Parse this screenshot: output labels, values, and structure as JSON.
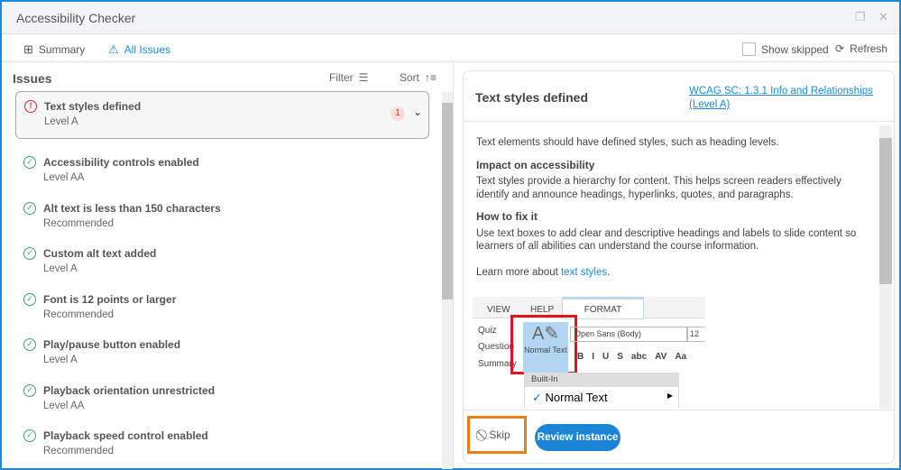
{
  "window": {
    "title": "Accessibility Checker"
  },
  "toolbar": {
    "summary": "Summary",
    "all_issues": "All Issues",
    "show_skipped": "Show skipped",
    "refresh": "Refresh"
  },
  "issues": {
    "heading": "Issues",
    "filter": "Filter",
    "sort": "Sort",
    "selected": {
      "title": "Text styles defined",
      "level": "Level A",
      "count": "1"
    },
    "items": [
      {
        "title": "Accessibility controls enabled",
        "level": "Level AA"
      },
      {
        "title": "Alt text is less than 150 characters",
        "level": "Recommended"
      },
      {
        "title": "Custom alt text added",
        "level": "Level A"
      },
      {
        "title": "Font is 12 points or larger",
        "level": "Recommended"
      },
      {
        "title": "Play/pause button enabled",
        "level": "Level A"
      },
      {
        "title": "Playback orientation unrestricted",
        "level": "Level AA"
      },
      {
        "title": "Playback speed control enabled",
        "level": "Recommended"
      }
    ]
  },
  "detail": {
    "title": "Text styles defined",
    "wcag_link": "WCAG SC: 1.3.1 Info and Relationships (Level A)",
    "intro": "Text elements should have defined styles, such as heading levels.",
    "impact_heading": "Impact on accessibility",
    "impact_text": "Text styles provide a hierarchy for content. This helps screen readers effectively identify and announce headings, hyperlinks, quotes, and paragraphs.",
    "fix_heading": "How to fix it",
    "fix_text": "Use text boxes to add clear and descriptive headings and labels to slide content so learners of all abilities can understand the course information.",
    "learn_more": "Learn more about ",
    "learn_link": "text styles",
    "learn_end": ".",
    "image": {
      "tabs": [
        "VIEW",
        "HELP",
        "FORMAT"
      ],
      "side": [
        "Quiz",
        "Question",
        "Summary"
      ],
      "style_btn": "Normal Text",
      "font": "Open Sans (Body)",
      "size": "12",
      "builtin": "Built-In",
      "menu_item": "Normal Text",
      "format_icons": [
        "B",
        "I",
        "U",
        "S",
        "abc",
        "AV",
        "Aa"
      ]
    },
    "skip": "Skip",
    "review": "Review instance"
  }
}
